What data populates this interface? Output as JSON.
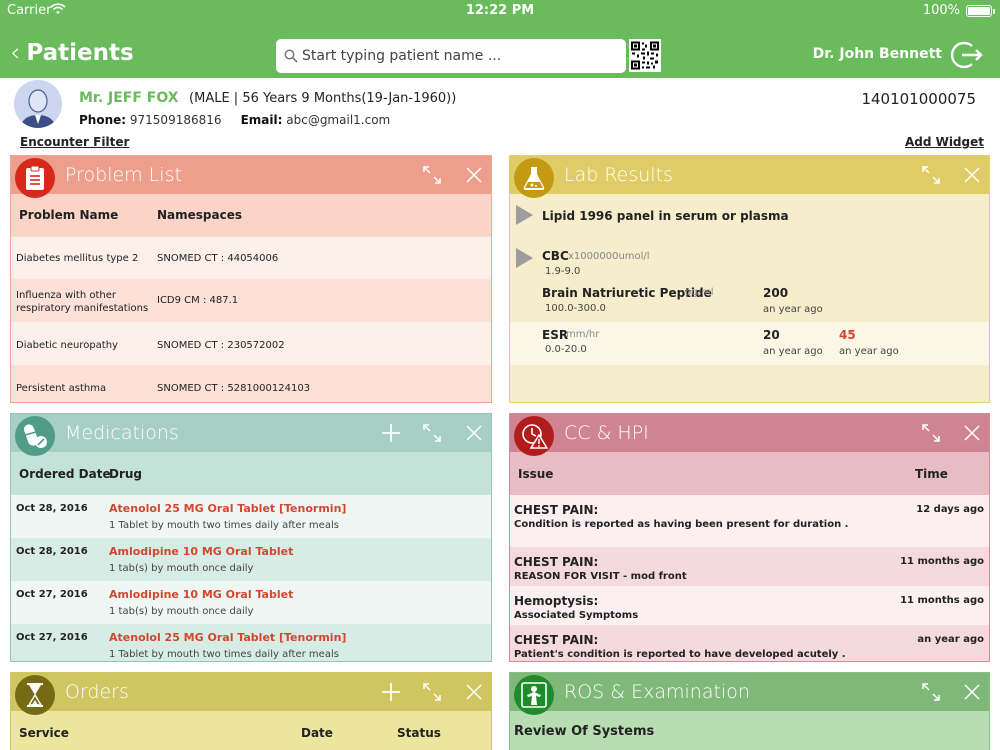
{
  "status_bar": {
    "carrier": "Carrier",
    "time": "12:22 PM",
    "battery": "100%"
  },
  "nav": {
    "back_title": "Patients",
    "search_placeholder": "Start typing patient name ...",
    "doctor": "Dr. John Bennett"
  },
  "patient": {
    "name": "Mr. JEFF FOX",
    "demographics": "(MALE | 56 Years 9 Months(19-Jan-1960))",
    "phone_label": "Phone:",
    "phone": "971509186816",
    "email_label": "Email:",
    "email": "abc@gmail1.com",
    "id": "140101000075"
  },
  "actions": {
    "encounter_filter": "Encounter Filter",
    "add_widget": "Add Widget"
  },
  "colors": {
    "brand_green": "#69bb5c",
    "alert_red": "#d3462f"
  },
  "problem_list": {
    "title": "Problem List",
    "headers": [
      "Problem Name",
      "Namespaces"
    ],
    "rows": [
      {
        "name": "Diabetes mellitus type 2",
        "ns": "SNOMED CT : 44054006"
      },
      {
        "name": "Influenza with other respiratory manifestations",
        "ns": "ICD9 CM : 487.1"
      },
      {
        "name": "Diabetic neuropathy",
        "ns": "SNOMED CT : 230572002"
      },
      {
        "name": "Persistent asthma",
        "ns": "SNOMED CT : 5281000124103"
      }
    ]
  },
  "lab_results": {
    "title": "Lab Results",
    "panel1": "Lipid 1996 panel in serum or plasma",
    "panel2": "CBC",
    "panel2_unit": "x1000000umol/l",
    "panel2_range": "1.9-9.0",
    "tests": [
      {
        "name": "Brain Natriuretic Peptide",
        "unit": "pg/ml",
        "range": "100.0-300.0",
        "v1": "200",
        "t1": "an year ago",
        "v2": "",
        "t2": ""
      },
      {
        "name": "ESR",
        "unit": "mm/hr",
        "range": "0.0-20.0",
        "v1": "20",
        "t1": "an year ago",
        "v2": "45",
        "t2": "an year ago"
      }
    ]
  },
  "medications": {
    "title": "Medications",
    "headers": [
      "Ordered Date",
      "Drug"
    ],
    "rows": [
      {
        "date": "Oct 28, 2016",
        "drug": "Atenolol 25 MG Oral Tablet [Tenormin]",
        "sig": "1 Tablet by mouth two times daily after meals"
      },
      {
        "date": "Oct 28, 2016",
        "drug": "Amlodipine 10 MG Oral Tablet",
        "sig": "1 tab(s) by mouth once daily"
      },
      {
        "date": "Oct 27, 2016",
        "drug": "Amlodipine 10 MG Oral Tablet",
        "sig": "1 tab(s) by mouth once daily"
      },
      {
        "date": "Oct 27, 2016",
        "drug": "Atenolol 25 MG Oral Tablet [Tenormin]",
        "sig": "1 Tablet by mouth two times daily after meals"
      }
    ]
  },
  "cc_hpi": {
    "title": "CC & HPI",
    "headers": [
      "Issue",
      "Time"
    ],
    "rows": [
      {
        "issue": "CHEST PAIN:",
        "detail": "Condition is reported as having been present for  duration .",
        "time": "12 days ago"
      },
      {
        "issue": "CHEST PAIN:",
        "detail": "REASON FOR VISIT - mod front",
        "time": "11 months ago"
      },
      {
        "issue": "Hemoptysis:",
        "detail": "Associated Symptoms",
        "time": "11 months ago"
      },
      {
        "issue": "CHEST PAIN:",
        "detail": "Patient's condition is reported to have developed acutely .",
        "time": "an year ago"
      }
    ]
  },
  "orders": {
    "title": "Orders",
    "headers": [
      "Service",
      "Date",
      "Status"
    ]
  },
  "ros": {
    "title": "ROS & Examination",
    "section": "Review Of Systems"
  }
}
